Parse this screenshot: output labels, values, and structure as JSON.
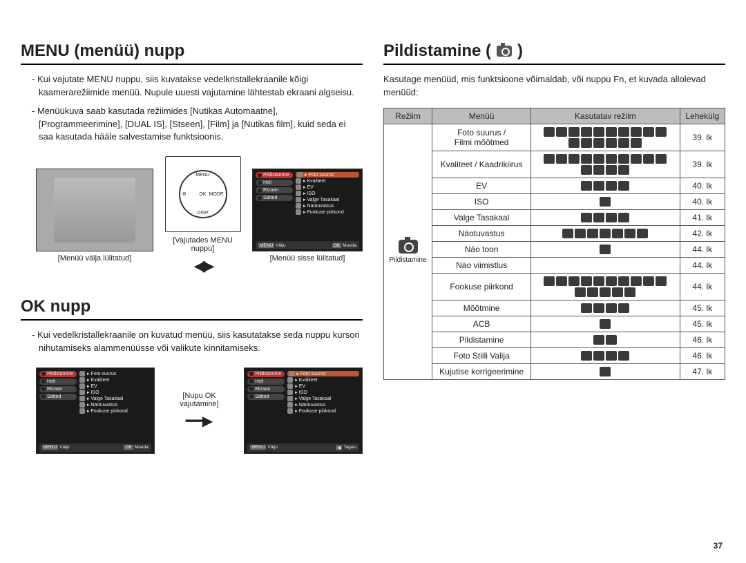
{
  "pageNumber": "37",
  "left": {
    "heading1": "MENU (menüü) nupp",
    "para1": "- Kui vajutate MENU nuppu, siis kuvatakse vedelkristallekraanile kõigi kaamerarežiimide menüü. Nupule uuesti vajutamine lähtestab ekraani algseisu.",
    "para2": "- Menüükuva saab kasutada režiimides [Nutikas Automaatne], [Programmeerimine], [DUAL IS], [Stseen], [Film] ja [Nutikas film], kuid seda ei saa kasutada hääle salvestamise funktsioonis.",
    "captionOff": "[Menüü välja lülitatud]",
    "captionPress": "[Vajutades MENU nuppu]",
    "captionOn": "[Menüü sisse lülitatud]",
    "dial": {
      "top": "MENU",
      "right": "MODE",
      "bottom": "DISP",
      "left": "⚙",
      "center": "OK"
    },
    "menuScreen1": {
      "sideItems": [
        "Pildistamine",
        "Heli",
        "Ekraan",
        "Sätted"
      ],
      "mainItems": [
        "Foto suurus",
        "Kvaliteet",
        "EV",
        "ISO",
        "Valge Tasakaal",
        "Näotuvastus",
        "Fookuse piirkond"
      ],
      "footLeft": "Välju",
      "footLeftBtn": "MENU",
      "footRight": "Muuda",
      "footRightBtn": "OK"
    },
    "heading2": "OK nupp",
    "para3": "- Kui vedelkristallekraanile on kuvatud menüü, siis kasutatakse seda nuppu kursori nihutamiseks alammenüüsse või valikute kinnitamiseks.",
    "captionOkPress": "[Nupu OK vajutamine]",
    "menuScreen2Foot": {
      "footLeft": "Välju",
      "footLeftBtn": "MENU",
      "footRight": "Muuda",
      "footRightBtn": "OK"
    },
    "menuScreen3Foot": {
      "footLeft": "Välju",
      "footLeftBtn": "MENU",
      "footRight": "Tagasi",
      "footRightBtn": "◀"
    }
  },
  "right": {
    "heading": "Pildistamine (",
    "headingClose": ")",
    "desc": "Kasutage menüüd, mis funktsioone võimaldab, või nuppu Fn, et kuvada allolevad menüüd:",
    "tableHead": [
      "Režiim",
      "Menüü",
      "Kasutatav režiim",
      "Lehekülg"
    ],
    "modeLabel": "Pildistamine",
    "rows": [
      {
        "menu": "Foto suurus /\nFilmi mõõtmed",
        "icons": 16,
        "page": "39. lk"
      },
      {
        "menu": "Kvaliteet / Kaadrikiirus",
        "icons": 14,
        "page": "39. lk"
      },
      {
        "menu": "EV",
        "icons": 4,
        "page": "40. lk"
      },
      {
        "menu": "ISO",
        "icons": 1,
        "page": "40. lk"
      },
      {
        "menu": "Valge Tasakaal",
        "icons": 4,
        "page": "41. lk"
      },
      {
        "menu": "Näotuvastus",
        "icons": 7,
        "page": "42. lk"
      },
      {
        "menu": "Näo toon",
        "icons": 1,
        "page": "44. lk"
      },
      {
        "menu": "Näo viimistlus",
        "icons": 1,
        "page": "44. lk",
        "hideIcons": true
      },
      {
        "menu": "Fookuse piirkond",
        "icons": 15,
        "page": "44. lk"
      },
      {
        "menu": "Mõõtmine",
        "icons": 4,
        "page": "45. lk"
      },
      {
        "menu": "ACB",
        "icons": 1,
        "page": "45. lk"
      },
      {
        "menu": "Pildistamine",
        "icons": 2,
        "page": "46. lk"
      },
      {
        "menu": "Foto Stiili Valija",
        "icons": 4,
        "page": "46. lk"
      },
      {
        "menu": "Kujutise korrigeerimine",
        "icons": 1,
        "page": "47. lk"
      }
    ]
  }
}
